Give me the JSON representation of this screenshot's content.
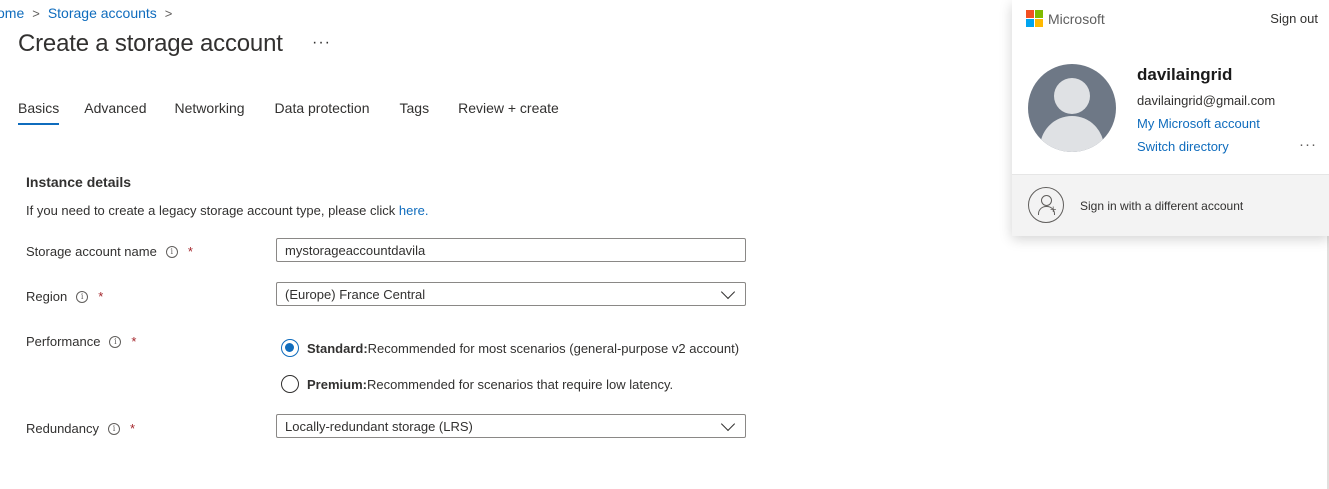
{
  "breadcrumb": {
    "home": "ome",
    "storage": "Storage accounts"
  },
  "page": {
    "title": "Create a storage account",
    "more": "···"
  },
  "tabs": [
    {
      "label": "Basics",
      "active": true
    },
    {
      "label": "Advanced"
    },
    {
      "label": "Networking"
    },
    {
      "label": "Data protection"
    },
    {
      "label": "Tags"
    },
    {
      "label": "Review + create"
    }
  ],
  "instance": {
    "title": "Instance details",
    "note": "If you need to create a legacy storage account type, please click ",
    "note_link": "here."
  },
  "form": {
    "name_label": "Storage account name",
    "name_value": "mystorageaccountdavila",
    "region_label": "Region",
    "region_value": "(Europe) France Central",
    "performance_label": "Performance",
    "standard_bold": "Standard:",
    "standard_text": " Recommended for most scenarios (general-purpose v2 account)",
    "premium_bold": "Premium:",
    "premium_text": " Recommended for scenarios that require low latency.",
    "redundancy_label": "Redundancy",
    "redundancy_value": "Locally-redundant storage (LRS)",
    "required_mark": "*",
    "info_mark": "i"
  },
  "account": {
    "brand": "Microsoft",
    "signout": "Sign out",
    "name": "davilaingrid",
    "email": "davilaingrid@gmail.com",
    "my_account": "My Microsoft account",
    "switch_directory": "Switch directory",
    "more": "···",
    "different": "Sign in with a different account",
    "logo_colors": [
      "#f25022",
      "#7fba00",
      "#00a4ef",
      "#ffb900"
    ]
  },
  "colors": {
    "accent": "#0f6cbd",
    "required": "#a4262c"
  }
}
